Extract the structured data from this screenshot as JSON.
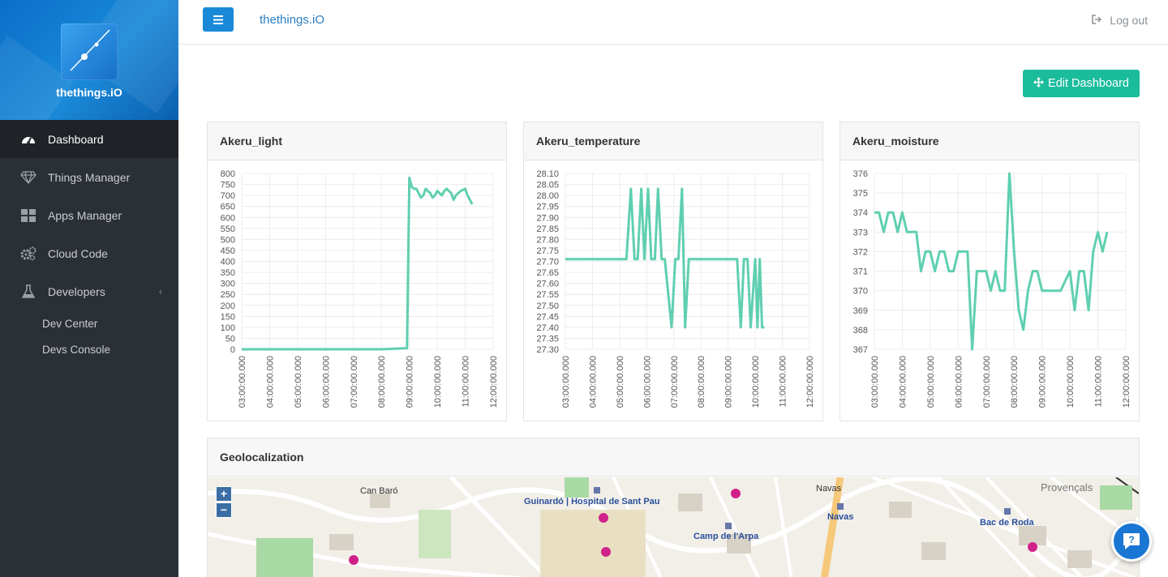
{
  "app": {
    "brand_name": "thethings.iO",
    "top_logo_text": "thethings.iO",
    "logout_label": "Log out",
    "accent_color": "#1abc9c",
    "brand_color": "#1a8ad8"
  },
  "sidebar": {
    "items": [
      {
        "label": "Dashboard",
        "icon": "dashboard-gauge-icon",
        "active": true
      },
      {
        "label": "Things Manager",
        "icon": "diamond-icon"
      },
      {
        "label": "Apps Manager",
        "icon": "grid-icon"
      },
      {
        "label": "Cloud Code",
        "icon": "gears-icon"
      },
      {
        "label": "Developers",
        "icon": "flask-icon",
        "expandable": true
      }
    ],
    "sub_items": [
      {
        "label": "Dev Center"
      },
      {
        "label": "Devs Console"
      }
    ]
  },
  "main": {
    "edit_dashboard_label": "Edit Dashboard",
    "map_title": "Geolocalization",
    "map_labels": [
      "Can Baró",
      "Guinardó | Hospital de Sant Pau",
      "Camp de l'Arpa",
      "Navas",
      "Navas",
      "Bac de Roda",
      "Provençals"
    ]
  },
  "chart_data": [
    {
      "type": "line",
      "title": "Akeru_light",
      "x_ticks": [
        "03:00:00.000",
        "04:00:00.000",
        "05:00:00.000",
        "06:00:00.000",
        "07:00:00.000",
        "08:00:00.000",
        "09:00:00.000",
        "10:00:00.000",
        "11:00:00.000",
        "12:00:00.000"
      ],
      "xlim": [
        "03:00",
        "12:00"
      ],
      "ylim": [
        0,
        800
      ],
      "y_ticks": [
        0,
        50,
        100,
        150,
        200,
        250,
        300,
        350,
        400,
        450,
        500,
        550,
        600,
        650,
        700,
        750,
        800
      ],
      "series": [
        {
          "color": "#5fcfb0",
          "x": [
            "03:00",
            "04:00",
            "05:00",
            "06:00",
            "07:00",
            "08:00",
            "08:55",
            "09:00",
            "09:05",
            "09:10",
            "09:15",
            "09:20",
            "09:25",
            "09:30",
            "09:35",
            "09:40",
            "09:45",
            "09:50",
            "09:55",
            "10:00",
            "10:05",
            "10:10",
            "10:15",
            "10:20",
            "10:25",
            "10:30",
            "10:35",
            "10:40",
            "10:45",
            "10:50",
            "10:55",
            "11:00",
            "11:05",
            "11:10",
            "11:15"
          ],
          "y": [
            0,
            0,
            0,
            0,
            0,
            0,
            5,
            780,
            740,
            730,
            730,
            710,
            690,
            700,
            730,
            720,
            710,
            690,
            700,
            720,
            710,
            700,
            720,
            730,
            720,
            710,
            680,
            700,
            710,
            720,
            725,
            730,
            700,
            680,
            660
          ]
        }
      ]
    },
    {
      "type": "line",
      "title": "Akeru_temperature",
      "x_ticks": [
        "03:00:00.000",
        "04:00:00.000",
        "05:00:00.000",
        "06:00:00.000",
        "07:00:00.000",
        "08:00:00.000",
        "09:00:00.000",
        "10:00:00.000",
        "11:00:00.000",
        "12:00:00.000"
      ],
      "xlim": [
        "03:00",
        "12:00"
      ],
      "ylim": [
        27.3,
        28.1
      ],
      "y_ticks": [
        27.3,
        27.35,
        27.4,
        27.45,
        27.5,
        27.55,
        27.6,
        27.65,
        27.7,
        27.75,
        27.8,
        27.85,
        27.9,
        27.95,
        28.0,
        28.05,
        28.1
      ],
      "series": [
        {
          "color": "#5fcfb0",
          "x": [
            "03:00",
            "05:15",
            "05:25",
            "05:33",
            "05:40",
            "05:48",
            "05:55",
            "06:03",
            "06:10",
            "06:18",
            "06:25",
            "06:33",
            "06:40",
            "06:55",
            "07:03",
            "07:10",
            "07:18",
            "07:25",
            "07:33",
            "07:40",
            "07:48",
            "08:00",
            "08:30",
            "09:00",
            "09:20",
            "09:28",
            "09:35",
            "09:43",
            "09:50",
            "10:00",
            "10:05",
            "10:10",
            "10:15",
            "10:20"
          ],
          "y": [
            27.71,
            27.71,
            28.03,
            27.71,
            27.71,
            28.03,
            27.71,
            28.03,
            27.71,
            27.71,
            28.03,
            27.71,
            27.71,
            27.4,
            27.71,
            27.71,
            28.03,
            27.4,
            27.71,
            27.71,
            27.71,
            27.71,
            27.71,
            27.71,
            27.71,
            27.4,
            27.71,
            27.71,
            27.4,
            27.71,
            27.4,
            27.71,
            27.4,
            27.4
          ]
        }
      ]
    },
    {
      "type": "line",
      "title": "Akeru_moisture",
      "x_ticks": [
        "03:00:00.000",
        "04:00:00.000",
        "05:00:00.000",
        "06:00:00.000",
        "07:00:00.000",
        "08:00:00.000",
        "09:00:00.000",
        "10:00:00.000",
        "11:00:00.000",
        "12:00:00.000"
      ],
      "xlim": [
        "03:00",
        "12:00"
      ],
      "ylim": [
        367,
        376
      ],
      "y_ticks": [
        367,
        368,
        369,
        370,
        371,
        372,
        373,
        374,
        375,
        376
      ],
      "series": [
        {
          "color": "#5fcfb0",
          "x": [
            "03:00",
            "03:10",
            "03:20",
            "03:30",
            "03:40",
            "03:50",
            "04:00",
            "04:10",
            "04:20",
            "04:30",
            "04:40",
            "04:50",
            "05:00",
            "05:10",
            "05:20",
            "05:30",
            "05:40",
            "05:50",
            "06:00",
            "06:10",
            "06:20",
            "06:30",
            "06:40",
            "06:50",
            "07:00",
            "07:10",
            "07:20",
            "07:30",
            "07:40",
            "07:50",
            "08:00",
            "08:10",
            "08:20",
            "08:30",
            "08:40",
            "08:50",
            "09:00",
            "09:20",
            "09:40",
            "10:00",
            "10:10",
            "10:20",
            "10:30",
            "10:40",
            "10:50",
            "11:00",
            "11:10",
            "11:20"
          ],
          "y": [
            374,
            374,
            373,
            374,
            374,
            373,
            374,
            373,
            373,
            373,
            371,
            372,
            372,
            371,
            372,
            372,
            371,
            371,
            372,
            372,
            372,
            367,
            371,
            371,
            371,
            370,
            371,
            370,
            370,
            376,
            372,
            369,
            368,
            370,
            371,
            371,
            370,
            370,
            370,
            371,
            369,
            371,
            371,
            369,
            372,
            373,
            372,
            373
          ]
        }
      ]
    }
  ]
}
